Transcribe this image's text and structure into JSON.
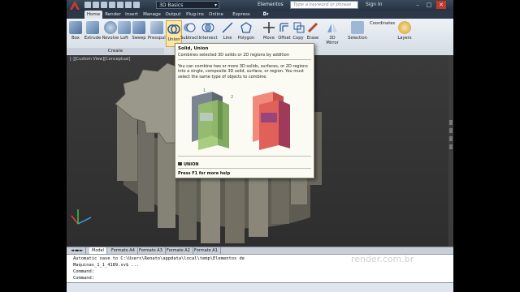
{
  "titlebar": {
    "workspace": "3D Basics",
    "document": "Elementos",
    "search_placeholder": "Type a keyword or phrase",
    "signin": "Sign In",
    "minimize": "–",
    "maximize": "□",
    "close": "✕"
  },
  "tabs": [
    "Home",
    "Render",
    "Insert",
    "Manage",
    "Output",
    "Plug-ins",
    "Online",
    "Express Tools"
  ],
  "ribbon": {
    "buttons": [
      "Box",
      "Extrude",
      "Revolve",
      "Loft",
      "Sweep",
      "Presspull",
      "Union",
      "Subtract",
      "Intersect",
      "Line",
      "Polygon",
      "Move",
      "Offset",
      "Copy",
      "Erase",
      "3D Mirror",
      "Selection",
      "Coordinates",
      "Layers"
    ],
    "group_create": "Create"
  },
  "viewport": {
    "label": "[-][Custom View][Conceptual]"
  },
  "tooltip": {
    "title": "Solid, Union",
    "subtitle": "Combines selected 3D solids or 2D regions by addition",
    "body": "You can combine two or more 3D solids, surfaces, or 2D regions into a single, composite 3D solid, surface, or region. You must select the same type of objects to combine.",
    "label_1": "1",
    "label_2": "2",
    "command": "UNION",
    "help": "Press F1 for more help"
  },
  "layout_tabs": [
    "Model",
    "Formato A4",
    "Formato A3",
    "Formato A2",
    "Formato A1"
  ],
  "command_line": {
    "line1": "Automatic save to C:\\Users\\Renato\\appdata\\local\\temp\\Elementos de",
    "line2": "Maquinas_1_1_4189.sv$ ...",
    "line3": "Command:",
    "line4": "Command:"
  },
  "watermark": "render.com.br",
  "colors": {
    "accent": "#1e4f8c",
    "gear": "#8d8a7e"
  }
}
